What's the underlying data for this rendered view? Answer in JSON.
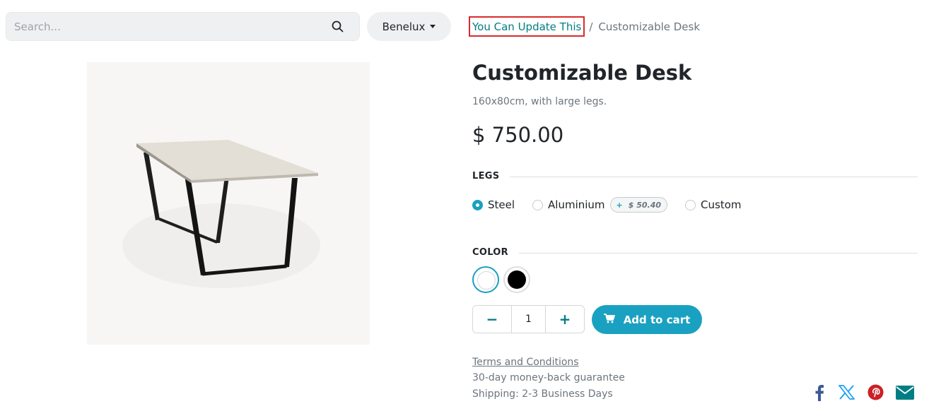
{
  "search": {
    "placeholder": "Search...",
    "value": ""
  },
  "pricelist": {
    "label": "Benelux"
  },
  "breadcrumb": {
    "parent": "You Can Update This",
    "separator": "/",
    "current": "Customizable Desk"
  },
  "product": {
    "name": "Customizable Desk",
    "description": "160x80cm, with large legs.",
    "price": "$ 750.00"
  },
  "attributes": {
    "legs": {
      "label": "LEGS",
      "options": [
        {
          "label": "Steel",
          "selected": true
        },
        {
          "label": "Aluminium",
          "selected": false,
          "extra_sign": "+",
          "extra_price": "$ 50.40"
        },
        {
          "label": "Custom",
          "selected": false
        }
      ]
    },
    "color": {
      "label": "COLOR",
      "options": [
        {
          "name": "White",
          "hex": "#ffffff",
          "selected": true
        },
        {
          "name": "Black",
          "hex": "#000000",
          "selected": false
        }
      ]
    }
  },
  "quantity": {
    "value": "1",
    "minus": "−",
    "plus": "+"
  },
  "cart": {
    "label": "Add to cart"
  },
  "info": {
    "terms": "Terms and Conditions",
    "guarantee": "30-day money-back guarantee",
    "shipping": "Shipping: 2-3 Business Days"
  },
  "share": [
    "facebook-icon",
    "x-twitter-icon",
    "pinterest-icon",
    "email-icon"
  ],
  "colors": {
    "accent": "#1aa1c1",
    "link": "#017e84",
    "highlight_border": "#d92b2b",
    "muted": "#6c757d"
  }
}
